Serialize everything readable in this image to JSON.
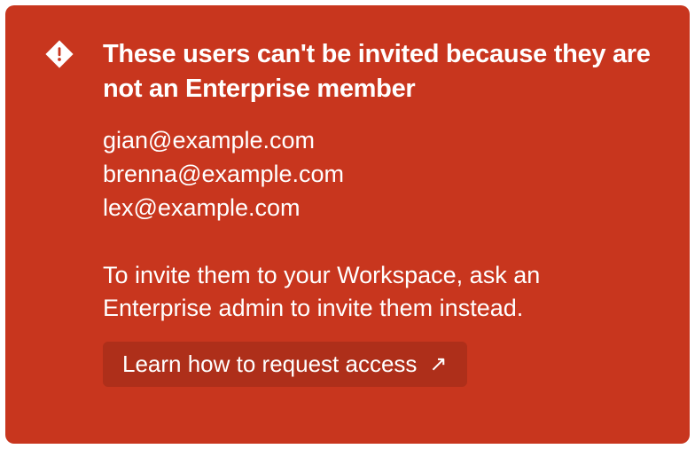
{
  "alert": {
    "title": "These users can't be invited because they are not an Enterprise member",
    "users": [
      "gian@example.com",
      "brenna@example.com",
      "lex@example.com"
    ],
    "instruction": "To invite them to your Workspace, ask an Enterprise admin to invite them instead.",
    "action_label": "Learn how to request access",
    "icon": "warning-icon",
    "action_icon": "external-link-arrow",
    "colors": {
      "background": "#c8361e",
      "button_background": "#ae2f1a",
      "text": "#ffffff"
    }
  }
}
